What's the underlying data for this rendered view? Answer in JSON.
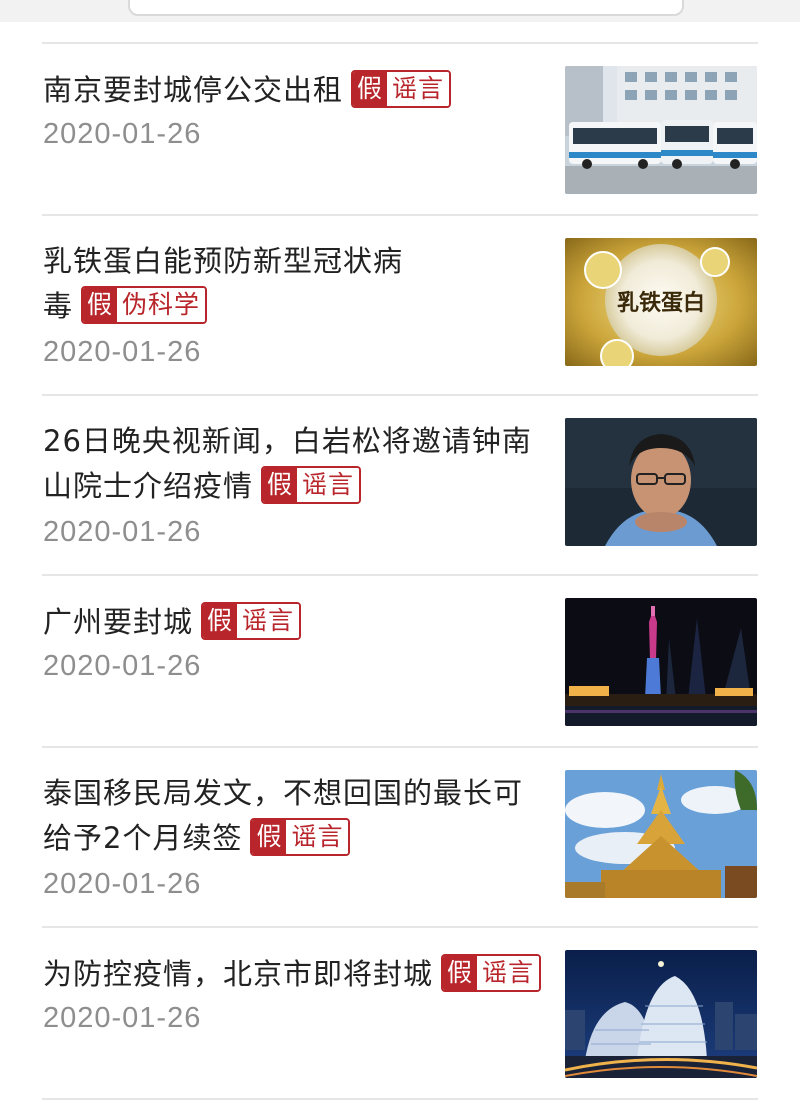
{
  "colors": {
    "accent": "#b8262b",
    "date": "#8e8e8e",
    "title": "#222222"
  },
  "articles": [
    {
      "title": "南京要封城停公交出租",
      "verdict": "假",
      "category": "谣言",
      "date": "2020-01-26",
      "thumbnail": "buses-photo"
    },
    {
      "title": "乳铁蛋白能预防新型冠状病毒",
      "verdict": "假",
      "category": "伪科学",
      "date": "2020-01-26",
      "thumbnail": "lactoferrin-video",
      "thumbnail_text": "乳铁蛋白"
    },
    {
      "title": "26日晚央视新闻，白岩松将邀请钟南山院士介绍疫情",
      "verdict": "假",
      "category": "谣言",
      "date": "2020-01-26",
      "thumbnail": "man-portrait-photo"
    },
    {
      "title": "广州要封城",
      "verdict": "假",
      "category": "谣言",
      "date": "2020-01-26",
      "thumbnail": "canton-tower-night-photo"
    },
    {
      "title": "泰国移民局发文，不想回国的最长可给予2个月续签",
      "verdict": "假",
      "category": "谣言",
      "date": "2020-01-26",
      "thumbnail": "golden-pagoda-photo"
    },
    {
      "title": "为防控疫情，北京市即将封城",
      "verdict": "假",
      "category": "谣言",
      "date": "2020-01-26",
      "thumbnail": "beijing-night-city-photo"
    }
  ]
}
